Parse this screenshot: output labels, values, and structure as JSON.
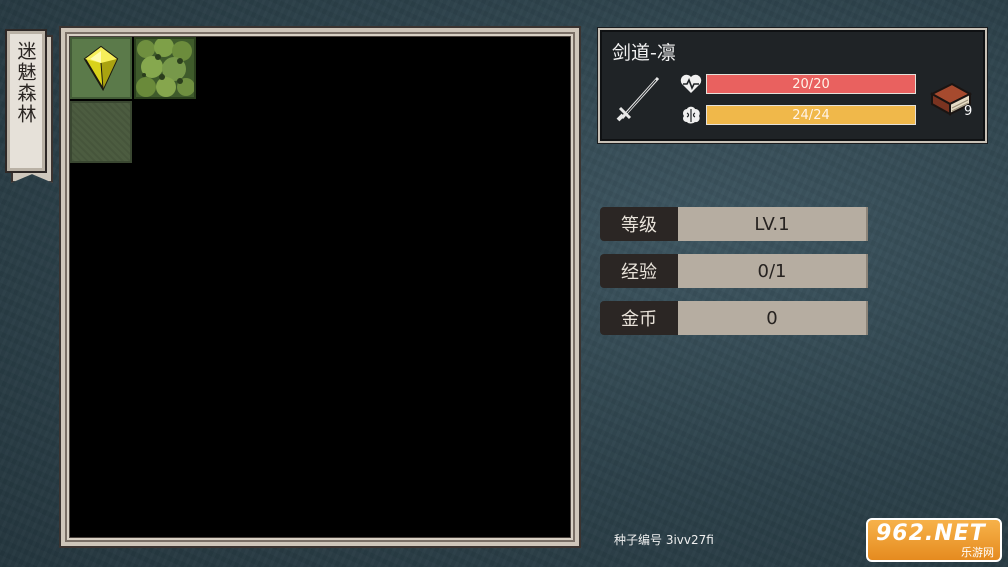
{
  "area": {
    "name": "迷魅森林"
  },
  "character": {
    "name": "剑道-凛",
    "weapon_icon": "sword-icon",
    "hp_text": "20/20",
    "hp_fraction": 1.0,
    "mp_text": "24/24",
    "mp_fraction": 1.0,
    "hp_color": "#e9615f",
    "mp_color": "#f0b84a",
    "book_count": "9"
  },
  "stats": [
    {
      "label": "等级",
      "value": "LV.1"
    },
    {
      "label": "经验",
      "value": "0/1"
    },
    {
      "label": "金币",
      "value": "0"
    }
  ],
  "map": {
    "tiles": [
      "crystal-tile",
      "forest-tile",
      "fog-tile"
    ]
  },
  "seed": {
    "text": "种子编号 3ivv27fi"
  },
  "watermark": {
    "main": "962.NET",
    "sub": "乐游网"
  }
}
